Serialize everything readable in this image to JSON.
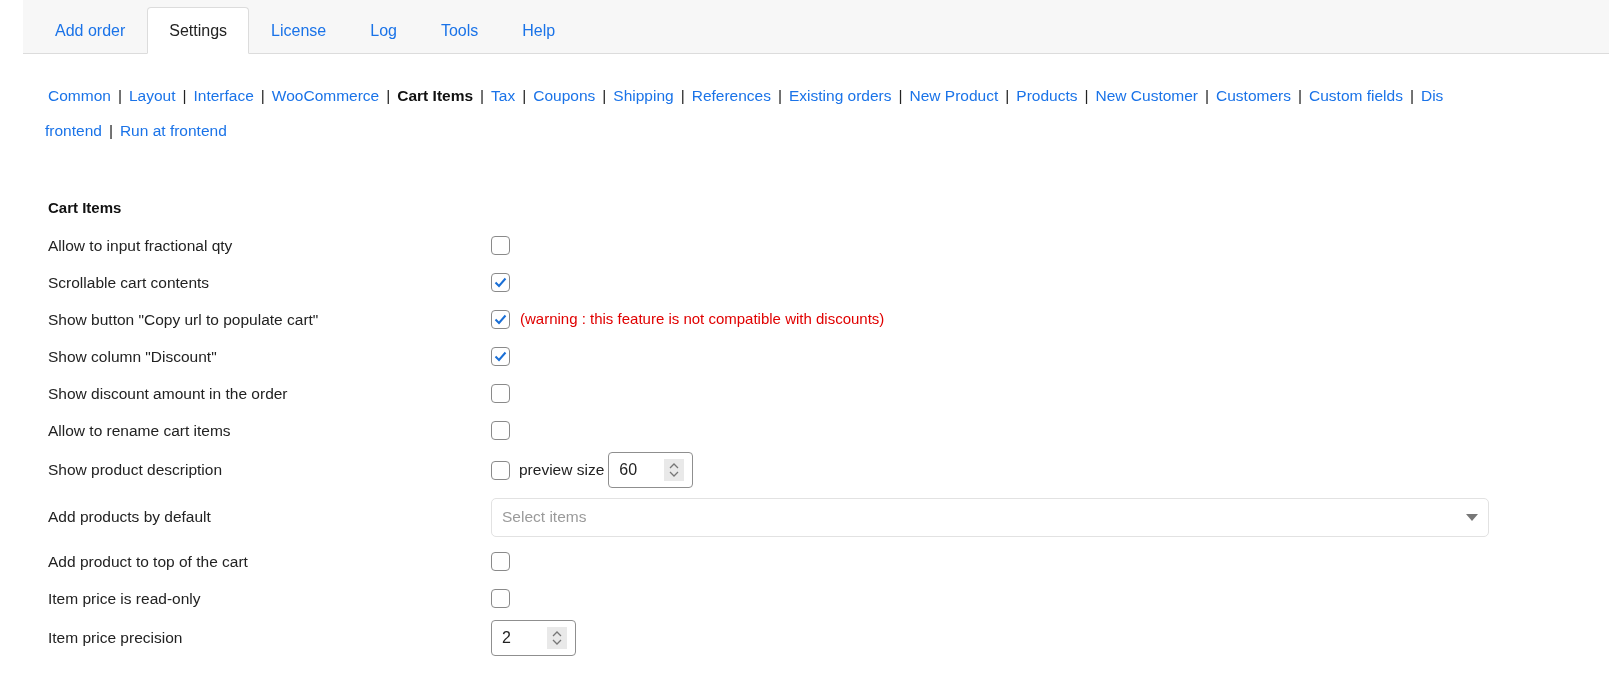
{
  "tabs": [
    {
      "label": "Add order",
      "selected": false
    },
    {
      "label": "Settings",
      "selected": true
    },
    {
      "label": "License",
      "selected": false
    },
    {
      "label": "Log",
      "selected": false
    },
    {
      "label": "Tools",
      "selected": false
    },
    {
      "label": "Help",
      "selected": false
    }
  ],
  "nav_lines": [
    [
      {
        "label": "Common",
        "selected": false
      },
      {
        "label": "Layout",
        "selected": false
      },
      {
        "label": "Interface",
        "selected": false
      },
      {
        "label": "WooCommerce",
        "selected": false
      },
      {
        "label": "Cart Items",
        "selected": true
      },
      {
        "label": "Tax",
        "selected": false
      },
      {
        "label": "Coupons",
        "selected": false
      },
      {
        "label": "Shipping",
        "selected": false
      },
      {
        "label": "References",
        "selected": false
      },
      {
        "label": "Existing orders",
        "selected": false
      },
      {
        "label": "New Product",
        "selected": false
      },
      {
        "label": "Products",
        "selected": false
      },
      {
        "label": "New Customer",
        "selected": false
      },
      {
        "label": "Customers",
        "selected": false
      },
      {
        "label": "Custom fields",
        "selected": false
      },
      {
        "label": "Dis",
        "selected": false
      }
    ],
    [
      {
        "label": "frontend",
        "selected": false
      },
      {
        "label": "Run at frontend",
        "selected": false
      }
    ]
  ],
  "separator": "|",
  "section": {
    "title": "Cart Items",
    "rows": [
      {
        "kind": "checkbox",
        "label": "Allow to input fractional qty",
        "checked": false
      },
      {
        "kind": "checkbox",
        "label": "Scrollable cart contents",
        "checked": true
      },
      {
        "kind": "checkbox",
        "label": "Show button \"Copy url to populate cart\"",
        "checked": true,
        "note": "(warning : this feature is not compatible with discounts)"
      },
      {
        "kind": "checkbox",
        "label": "Show column \"Discount\"",
        "checked": true
      },
      {
        "kind": "checkbox",
        "label": "Show discount amount in the order",
        "checked": false
      },
      {
        "kind": "checkbox",
        "label": "Allow to rename cart items",
        "checked": false
      },
      {
        "kind": "checkbox_number",
        "label": "Show product description",
        "checked": false,
        "number_label": "preview size",
        "value": "60"
      },
      {
        "kind": "select",
        "label": "Add products by default",
        "placeholder": "Select items"
      },
      {
        "kind": "checkbox",
        "label": "Add product to top of the cart",
        "checked": false
      },
      {
        "kind": "checkbox",
        "label": "Item price is read-only",
        "checked": false
      },
      {
        "kind": "number",
        "label": "Item price precision",
        "value": "2"
      }
    ]
  }
}
